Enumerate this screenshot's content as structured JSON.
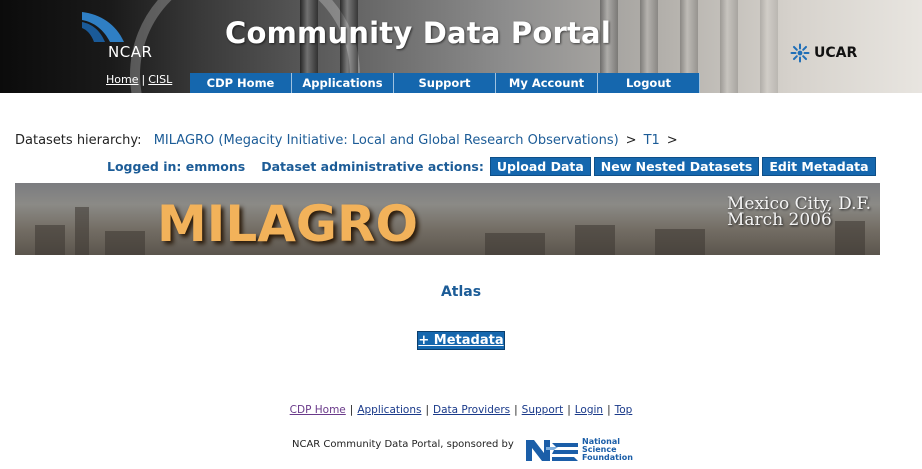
{
  "header": {
    "title": "Community Data Portal",
    "ncar_logo_text": "NCAR",
    "ucar_logo_text": "UCAR",
    "top_links": [
      "Home",
      "CISL"
    ],
    "nav": [
      "CDP Home",
      "Applications",
      "Support",
      "My Account",
      "Logout"
    ]
  },
  "breadcrumb": {
    "label": "Datasets hierarchy:",
    "items": [
      "MILAGRO (Megacity Initiative: Local and Global Research Observations)",
      "T1"
    ],
    "separator": ">"
  },
  "admin": {
    "logged_in": "Logged in: emmons",
    "actions_label": "Dataset administrative actions:",
    "buttons": [
      "Upload Data",
      "New Nested Datasets",
      "Edit Metadata"
    ]
  },
  "banner": {
    "title": "MILAGRO",
    "location_line1": "Mexico City, D.F.",
    "location_line2": "March 2006"
  },
  "main": {
    "dataset_title": "Atlas",
    "metadata_button": "+ Metadata"
  },
  "footer": {
    "links": [
      "CDP Home",
      "Applications",
      "Data Providers",
      "Support",
      "Login",
      "Top"
    ],
    "sponsor_text": "NCAR Community Data Portal, sponsored by",
    "nsf_logo_text": [
      "National",
      "Science",
      "Foundation"
    ]
  },
  "colors": {
    "nav_blue": "#1567ae",
    "link_blue": "#1c5c97",
    "banner_title_orange": "#f2b25a"
  }
}
